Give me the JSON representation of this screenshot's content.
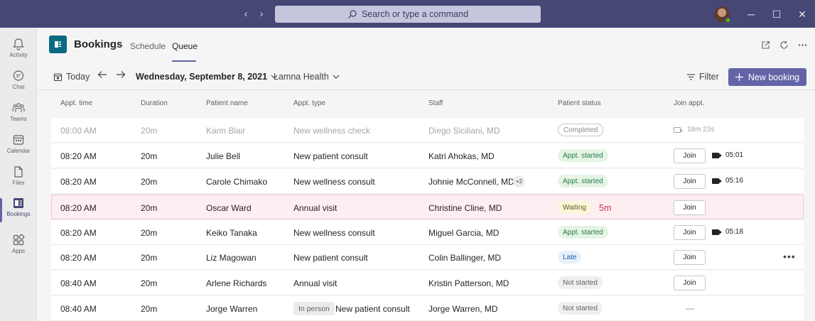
{
  "titlebar": {
    "search_placeholder": "Search or type a command",
    "back_glyph": "‹",
    "forward_glyph": "›",
    "minimize_glyph": "─",
    "maximize_glyph": "☐",
    "close_glyph": "✕"
  },
  "rail": {
    "items": [
      {
        "label": "Activity",
        "icon": "bell-icon"
      },
      {
        "label": "Chat",
        "icon": "chat-icon"
      },
      {
        "label": "Teams",
        "icon": "teams-icon"
      },
      {
        "label": "Calendar",
        "icon": "calendar-icon"
      },
      {
        "label": "Files",
        "icon": "file-icon"
      },
      {
        "label": "Bookings",
        "icon": "bookings-icon"
      },
      {
        "label": "Apps",
        "icon": "apps-icon"
      }
    ]
  },
  "header": {
    "app_title": "Bookings",
    "tabs": [
      {
        "label": "Schedule"
      },
      {
        "label": "Queue"
      }
    ],
    "active_tab": "Queue"
  },
  "toolbar": {
    "today_label": "Today",
    "date_label": "Wednesday, September 8, 2021",
    "location_label": "Lamna Health",
    "filter_label": "Filter",
    "new_booking_label": "New booking"
  },
  "table": {
    "columns": [
      "Appt. time",
      "Duration",
      "Patient name",
      "Appt. type",
      "Staff",
      "Patient status",
      "Join appt."
    ],
    "rows": [
      {
        "time": "08:00 AM",
        "duration": "20m",
        "patient": "Karin Blair",
        "type": "New wellness check",
        "staff": "Diego Siciliani, MD",
        "status": "Completed",
        "video_time": "18m 23s"
      },
      {
        "time": "08:20 AM",
        "duration": "20m",
        "patient": "Julie Bell",
        "type": "New patient consult",
        "staff": "Katri Ahokas, MD",
        "status": "Appt. started",
        "join": "Join",
        "video_time": "05:01"
      },
      {
        "time": "08:20 AM",
        "duration": "20m",
        "patient": "Carole Chimako",
        "type": "New wellness consult",
        "staff": "Johnie McConnell, MD",
        "staff_extra": "+2",
        "status": "Appt. started",
        "join": "Join",
        "video_time": "05:16"
      },
      {
        "time": "08:20 AM",
        "duration": "20m",
        "patient": "Oscar Ward",
        "type": "Annual visit",
        "staff": "Christine Cline, MD",
        "status": "Waiting",
        "wait": "5m",
        "join": "Join"
      },
      {
        "time": "08:20 AM",
        "duration": "20m",
        "patient": "Keiko Tanaka",
        "type": "New wellness consult",
        "staff": "Miguel Garcia, MD",
        "status": "Appt. started",
        "join": "Join",
        "video_time": "05:18"
      },
      {
        "time": "08:20 AM",
        "duration": "20m",
        "patient": "Liz Magowan",
        "type": "New patient consult",
        "staff": "Colin Ballinger, MD",
        "status": "Late",
        "join": "Join",
        "more": "•••"
      },
      {
        "time": "08:40 AM",
        "duration": "20m",
        "patient": "Arlene Richards",
        "type": "Annual visit",
        "staff": "Kristin Patterson, MD",
        "status": "Not started",
        "join": "Join"
      },
      {
        "time": "08:40 AM",
        "duration": "20m",
        "patient": "Jorge Warren",
        "type_tag": "In person",
        "type": "New patient consult",
        "staff": "Jorge Warren, MD",
        "status": "Not started",
        "join_placeholder": "—"
      }
    ]
  },
  "colors": {
    "titlebar": "#464775",
    "accent": "#6264a7",
    "bookings_logo": "#0b6a81",
    "waiting_text": "#c4314b"
  }
}
